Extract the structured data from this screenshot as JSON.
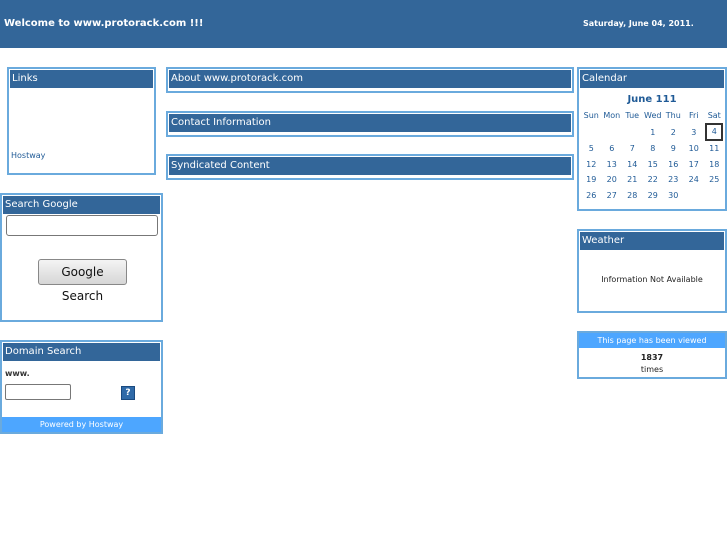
{
  "header": {
    "welcome": "Welcome to www.protorack.com !!!",
    "date": "Saturday, June 04, 2011."
  },
  "links": {
    "title": "Links",
    "items": [
      "Hostway"
    ]
  },
  "search_google": {
    "title": "Search Google",
    "button": "Google Search"
  },
  "domain_search": {
    "title": "Domain Search",
    "prefix": "www.",
    "help": "?",
    "powered": "Powered by Hostway"
  },
  "center": {
    "about": "About www.protorack.com",
    "contact": "Contact Information",
    "syndicated": "Syndicated Content"
  },
  "calendar": {
    "title": "Calendar",
    "month": "June 111",
    "days": [
      "Sun",
      "Mon",
      "Tue",
      "Wed",
      "Thu",
      "Fri",
      "Sat"
    ],
    "weeks": [
      [
        "",
        "",
        "",
        "1",
        "2",
        "3",
        "4"
      ],
      [
        "5",
        "6",
        "7",
        "8",
        "9",
        "10",
        "11"
      ],
      [
        "12",
        "13",
        "14",
        "15",
        "16",
        "17",
        "18"
      ],
      [
        "19",
        "20",
        "21",
        "22",
        "23",
        "24",
        "25"
      ],
      [
        "26",
        "27",
        "28",
        "29",
        "30",
        "",
        ""
      ]
    ],
    "today": "4"
  },
  "weather": {
    "title": "Weather",
    "message": "Information Not Available"
  },
  "counter": {
    "label": "This page has been viewed",
    "count": "1837",
    "suffix": "times"
  }
}
